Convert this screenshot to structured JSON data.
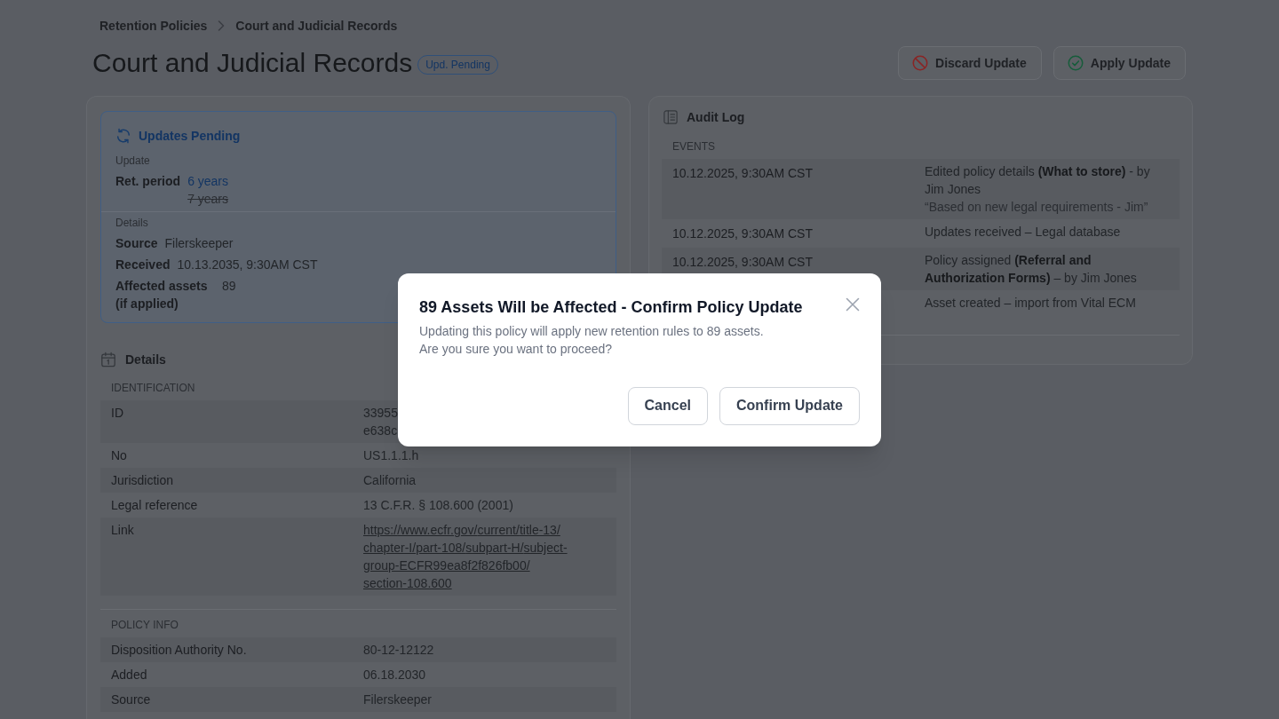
{
  "breadcrumb": [
    {
      "label": "Retention Policies"
    },
    {
      "label": "Court and Judicial Records"
    }
  ],
  "header": {
    "title": "Court and Judicial Records",
    "badge": "Upd. Pending",
    "actions": [
      {
        "label": "Discard Update",
        "kind": "discard"
      },
      {
        "label": "Apply Update",
        "kind": "apply"
      }
    ]
  },
  "pending_update": {
    "title": "Updates Pending",
    "sections": [
      {
        "heading": "Update",
        "fields": [
          {
            "label": "Ret. period",
            "value": "6 years",
            "previous": "7 years"
          }
        ]
      },
      {
        "heading": "Details",
        "fields": [
          {
            "label": "Source",
            "value": "Filerskeeper"
          },
          {
            "label": "Received",
            "value": "10.13.2035, 9:30AM CST"
          },
          {
            "label": "Affected assets (if applied)",
            "value": "89"
          }
        ]
      }
    ]
  },
  "details": {
    "title": "Details",
    "groups": [
      {
        "heading": "IDENTIFICATION",
        "rows": [
          {
            "label": "ID",
            "value": "33955\ne638c",
            "kind": "text"
          },
          {
            "label": "No",
            "value": "US1.1.1.h",
            "kind": "text"
          },
          {
            "label": "Jurisdiction",
            "value": "California",
            "kind": "text"
          },
          {
            "label": "Legal reference",
            "value": "13 C.F.R. § 108.600 (2001)",
            "kind": "text"
          },
          {
            "label": "Link",
            "value": "https://www.ecfr.gov/current/title-13/chapter-I/part-108/subpart-H/subject-group-ECFR99ea8f2f826fb00/section-108.600",
            "kind": "link"
          }
        ]
      },
      {
        "heading": "POLICY INFO",
        "rows": [
          {
            "label": "Disposition Authority No.",
            "value": "80-12-12122",
            "kind": "text"
          },
          {
            "label": "Added",
            "value": "06.18.2030",
            "kind": "text"
          },
          {
            "label": "Source",
            "value": "Filerskeeper",
            "kind": "text"
          }
        ]
      }
    ]
  },
  "audit_log": {
    "title": "Audit Log",
    "heading": "EVENTS",
    "events": [
      {
        "time": "10.12.2025, 9:30AM CST",
        "description": "Edited policy details **(What to store)** - by Jim Jones",
        "comment": "“Based on new legal requirements - Jim”"
      },
      {
        "time": "10.12.2025, 9:30AM CST",
        "description": "Updates received – Legal database"
      },
      {
        "time": "10.12.2025, 9:30AM CST",
        "description": "Policy assigned **(Referral and Authorization Forms)** – by Jim Jones"
      },
      {
        "description": "Asset created – import from Vital ECM"
      }
    ]
  },
  "dialog": {
    "title": "89 Assets Will be Affected - Confirm Policy Update",
    "message": [
      "Updating this policy will apply new retention rules to 89 assets.",
      "Are you sure you want to proceed?"
    ],
    "buttons": [
      {
        "label": "Cancel"
      },
      {
        "label": "Confirm Update"
      }
    ]
  }
}
